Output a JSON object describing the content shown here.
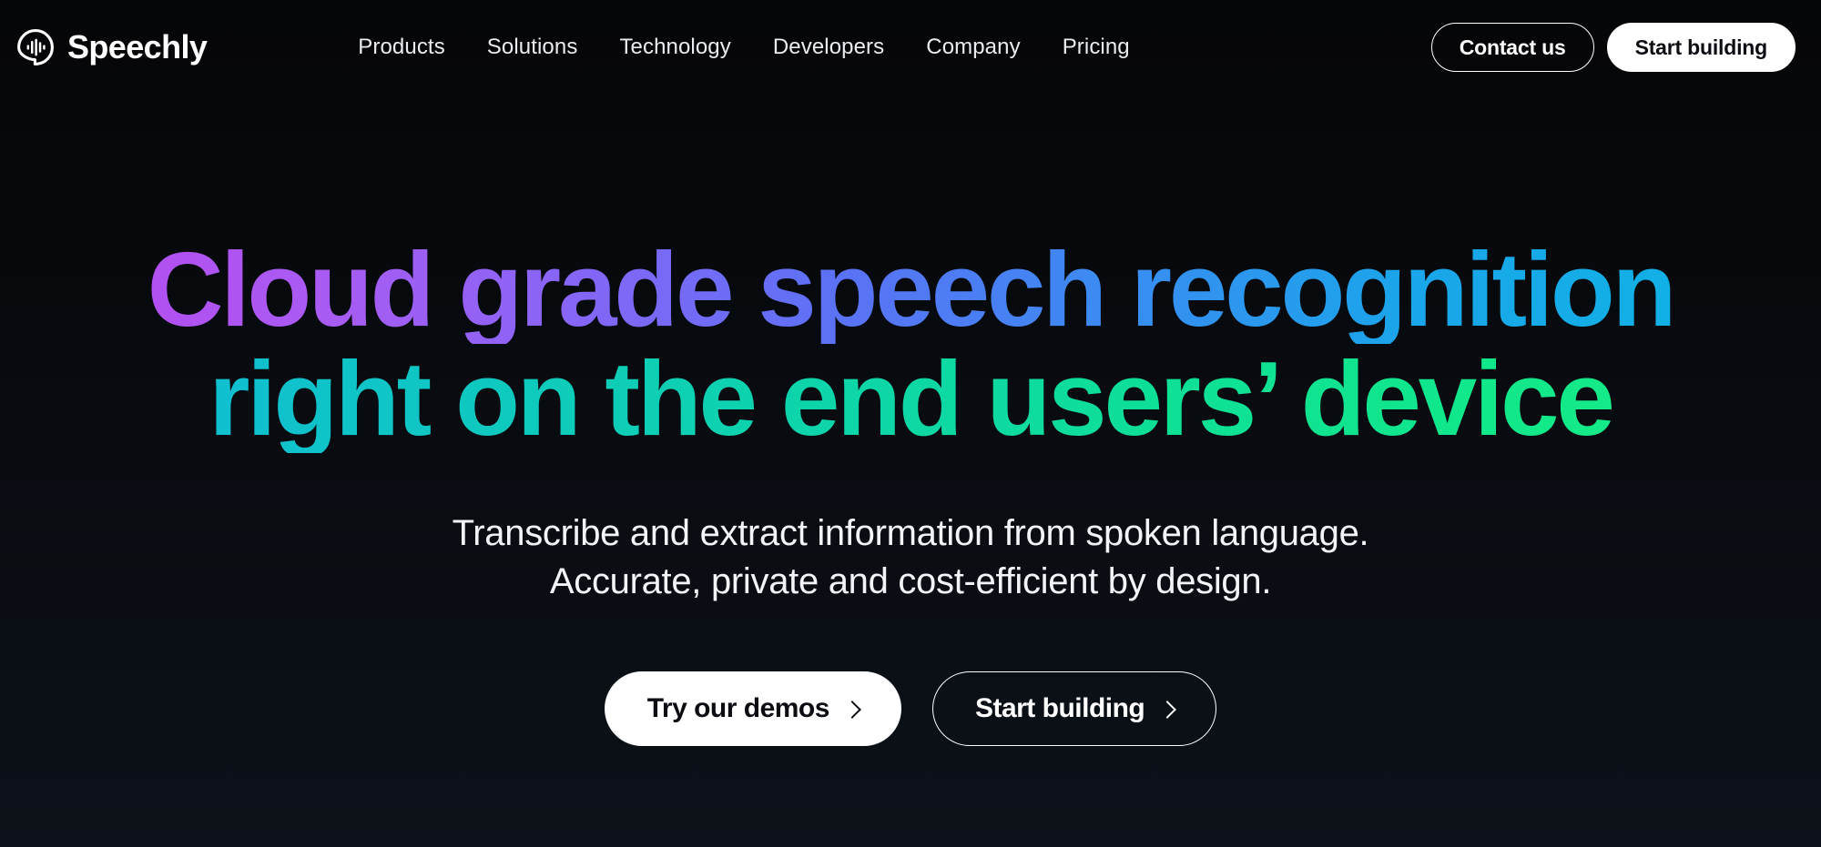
{
  "brand": {
    "name": "Speechly",
    "logo_icon": "speech-bubble-waveform-icon"
  },
  "nav": {
    "links": [
      {
        "label": "Products"
      },
      {
        "label": "Solutions"
      },
      {
        "label": "Technology"
      },
      {
        "label": "Developers"
      },
      {
        "label": "Company"
      },
      {
        "label": "Pricing"
      }
    ],
    "contact_label": "Contact us",
    "start_building_label": "Start building"
  },
  "hero": {
    "headline_line_1": "Cloud grade speech recognition",
    "headline_line_2": "right on the end users’ device",
    "subhead_line_1": "Transcribe and extract information from spoken language.",
    "subhead_line_2": "Accurate, private and cost-efficient by design.",
    "cta_primary_label": "Try our demos",
    "cta_secondary_label": "Start building"
  },
  "colors": {
    "background_top": "#050608",
    "background_bottom": "#0c1119",
    "text_primary": "#ffffff",
    "nav_link": "#e9ecf1",
    "gradient_purple": "#b54cf0",
    "gradient_violet": "#8566f7",
    "gradient_blue": "#3b8bf2",
    "gradient_cyan": "#0fb3e4",
    "gradient_teal": "#0fc5c6",
    "gradient_green": "#11e88a"
  }
}
